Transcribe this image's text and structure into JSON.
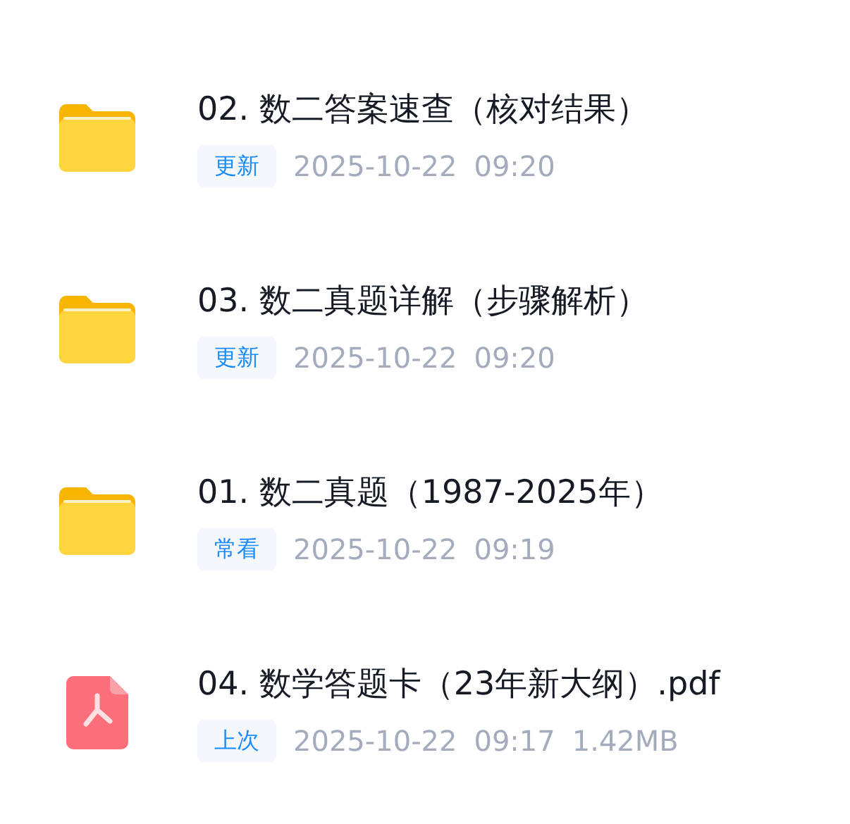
{
  "files": [
    {
      "kind": "folder",
      "title": "02. 数二答案速查（核对结果）",
      "tag": "更新",
      "date": "2025-10-22",
      "time": "09:20"
    },
    {
      "kind": "folder",
      "title": "03. 数二真题详解（步骤解析）",
      "tag": "更新",
      "date": "2025-10-22",
      "time": "09:20"
    },
    {
      "kind": "folder",
      "title": "01. 数二真题（1987-2025年）",
      "tag": "常看",
      "date": "2025-10-22",
      "time": "09:19"
    },
    {
      "kind": "pdf",
      "title": "04. 数学答题卡（23年新大纲）.pdf",
      "tag": "上次",
      "date": "2025-10-22",
      "time": "09:17",
      "size": "1.42MB"
    }
  ]
}
